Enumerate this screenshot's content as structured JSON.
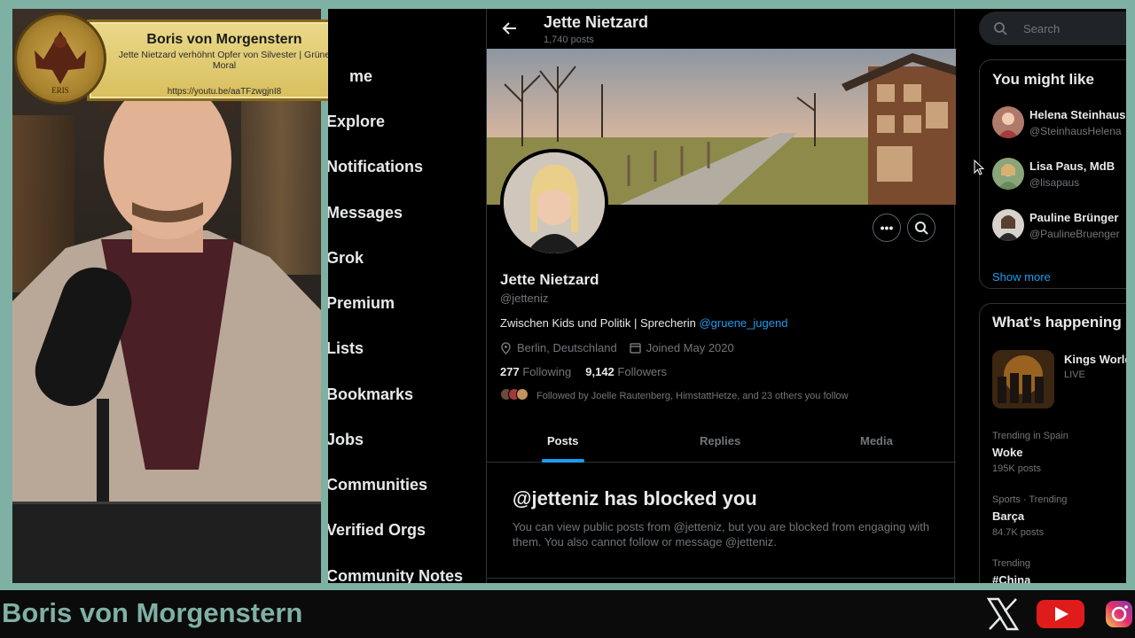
{
  "stream": {
    "streamer_name": "Boris von Morgenstern",
    "banner": {
      "title": "Boris von Morgenstern",
      "subtitle": "Jette Nietzard verhöhnt Opfer von Silvester | Grüne Moral",
      "url": "https://youtu.be/aaTFzwgjnI8",
      "logo_text": "ERIS"
    }
  },
  "nav": {
    "items": [
      {
        "label": "me"
      },
      {
        "label": "Explore"
      },
      {
        "label": "Notifications"
      },
      {
        "label": "Messages"
      },
      {
        "label": "Grok"
      },
      {
        "label": "Premium"
      },
      {
        "label": "Lists"
      },
      {
        "label": "Bookmarks"
      },
      {
        "label": "Jobs"
      },
      {
        "label": "Communities"
      },
      {
        "label": "Verified Orgs"
      },
      {
        "label": "Community Notes"
      }
    ]
  },
  "header": {
    "back_icon": "arrow-left-icon",
    "name": "Jette Nietzard",
    "posts": "1,740 posts"
  },
  "profile": {
    "name": "Jette Nietzard",
    "handle": "@jetteniz",
    "bio_text": "Zwischen Kids und Politik | Sprecherin ",
    "bio_link": "@gruene_jugend",
    "location": "Berlin, Deutschland",
    "joined": "Joined May 2020",
    "following_count": "277",
    "following_label": "Following",
    "followers_count": "9,142",
    "followers_label": "Followers",
    "followed_by": "Followed by Joelle Rautenberg, HimstattHetze, and 23 others you follow"
  },
  "tabs": [
    {
      "label": "Posts",
      "active": true
    },
    {
      "label": "Replies",
      "active": false
    },
    {
      "label": "Media",
      "active": false
    }
  ],
  "blocked": {
    "title": "@jetteniz has blocked you",
    "text": "You can view public posts from @jetteniz, but you are blocked from engaging with them. You also cannot follow or message @jetteniz."
  },
  "right": {
    "search_placeholder": "Search",
    "you_might_like": {
      "title": "You might like",
      "people": [
        {
          "name": "Helena Steinhaus",
          "handle": "@SteinhausHelena"
        },
        {
          "name": "Lisa Paus, MdB",
          "handle": "@lisapaus"
        },
        {
          "name": "Pauline Brünger",
          "handle": "@PaulineBruenger"
        }
      ],
      "show_more": "Show more"
    },
    "whats_happening": {
      "title": "What's happening",
      "live": {
        "title": "Kings World",
        "status": "LIVE"
      },
      "trends": [
        {
          "context": "Trending in Spain",
          "title": "Woke",
          "count": "195K posts"
        },
        {
          "context": "Sports · Trending",
          "title": "Barça",
          "count": "84.7K posts"
        },
        {
          "context": "Trending",
          "title": "#China",
          "count": ""
        }
      ]
    }
  },
  "colors": {
    "frame": "#7fb0a4",
    "link": "#1d9bf0",
    "muted": "#71767b",
    "text": "#e7e9ea",
    "border": "#2f3336"
  },
  "socials": [
    "x-logo-icon",
    "youtube-logo-icon",
    "instagram-logo-icon"
  ]
}
